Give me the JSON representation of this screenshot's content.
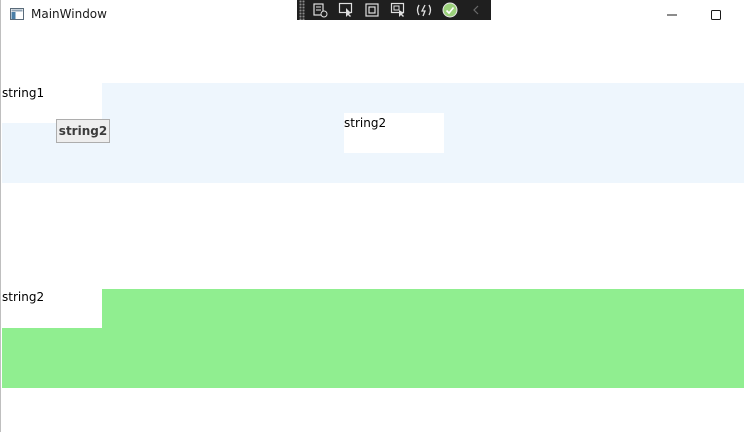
{
  "window": {
    "title": "MainWindow"
  },
  "debug_toolbar": {
    "icons": [
      "live-visual-tree-icon",
      "select-element-icon",
      "display-layout-adorners-icon",
      "track-focused-element-icon",
      "hot-reload-icon",
      "hot-reload-status-check-icon",
      "collapse-chevron-icon"
    ]
  },
  "content": {
    "blue_panel": {
      "label_top_left": "string1",
      "button_label": "string2",
      "label_center": "string2",
      "background": "#eef6fd"
    },
    "green_panel": {
      "label_top_left": "string2",
      "background": "#90ee90"
    }
  }
}
